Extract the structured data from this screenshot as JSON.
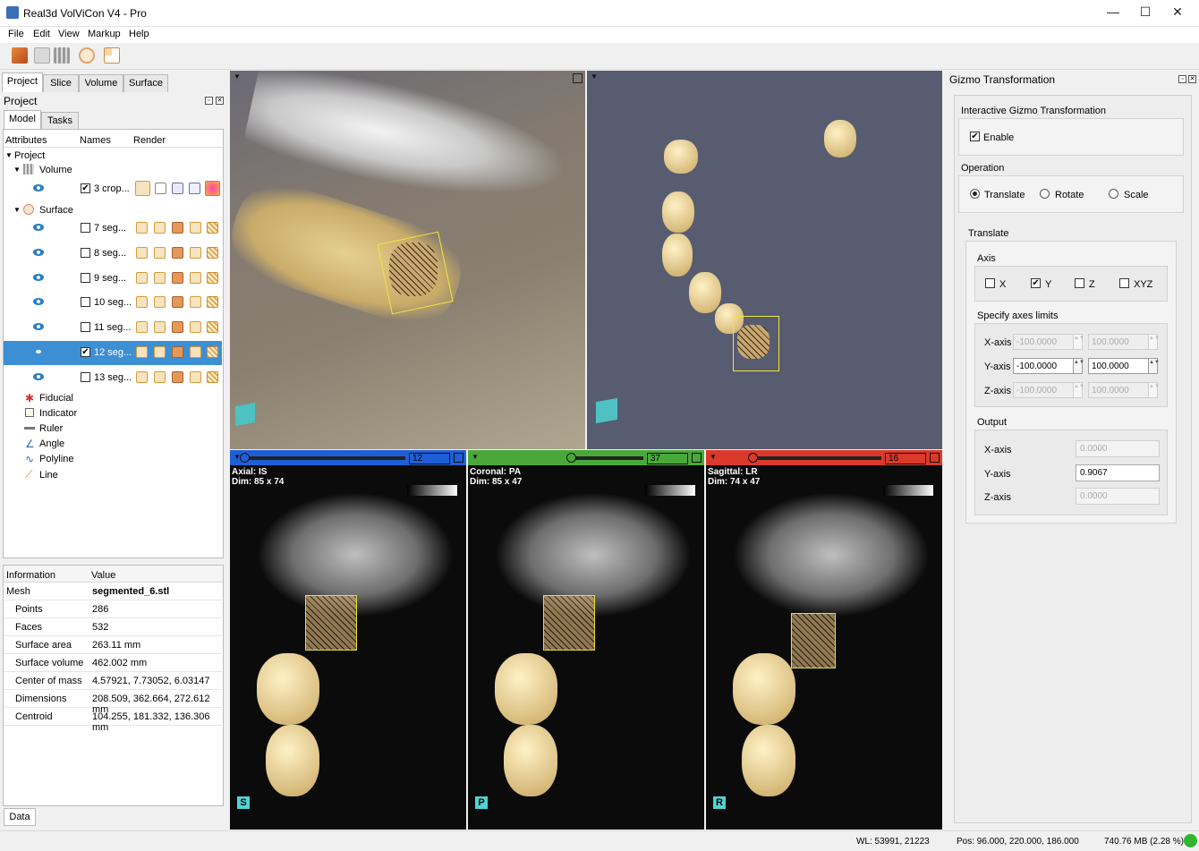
{
  "window": {
    "title": "Real3d VolViCon V4 - Pro",
    "minimize": "—",
    "maximize": "☐",
    "close": "✕"
  },
  "menu": [
    "File",
    "Edit",
    "View",
    "Markup",
    "Help"
  ],
  "left_tabs": [
    "Project",
    "Slice",
    "Volume",
    "Surface"
  ],
  "project_panel": {
    "title": "Project",
    "subtabs": [
      "Model",
      "Tasks"
    ],
    "columns": [
      "Attributes",
      "Names",
      "Render"
    ],
    "root": "Project",
    "volume_group": "Volume",
    "volume_item": {
      "name": "3 crop...",
      "checked": true
    },
    "surface_group": "Surface",
    "surface_items": [
      {
        "name": "7 seg...",
        "checked": false,
        "selected": false
      },
      {
        "name": "8 seg...",
        "checked": false,
        "selected": false
      },
      {
        "name": "9 seg...",
        "checked": false,
        "selected": false
      },
      {
        "name": "10 seg...",
        "checked": false,
        "selected": false
      },
      {
        "name": "11 seg...",
        "checked": false,
        "selected": false
      },
      {
        "name": "12 seg...",
        "checked": true,
        "selected": true
      },
      {
        "name": "13 seg...",
        "checked": false,
        "selected": false
      }
    ],
    "tools": [
      "Fiducial",
      "Indicator",
      "Ruler",
      "Angle",
      "Polyline",
      "Line"
    ]
  },
  "info_panel": {
    "columns": [
      "Information",
      "Value"
    ],
    "rows": [
      {
        "label": "Mesh",
        "value": "segmented_6.stl"
      },
      {
        "label": "Points",
        "value": "286"
      },
      {
        "label": "Faces",
        "value": "532"
      },
      {
        "label": "Surface area",
        "value": "263.11 mm"
      },
      {
        "label": "Surface volume",
        "value": "462.002 mm"
      },
      {
        "label": "Center of mass",
        "value": "4.57921, 7.73052, 6.03147"
      },
      {
        "label": "Dimensions",
        "value": "208.509, 362.664, 272.612 mm"
      },
      {
        "label": "Centroid",
        "value": "104.255, 181.332, 136.306 mm"
      }
    ],
    "bottom_tab": "Data"
  },
  "viewports": {
    "axial": {
      "slice": "12",
      "label": "Axial: IS",
      "dim": "Dim: 85 x 74",
      "orient": "S",
      "slider_fraction": 0.0
    },
    "coronal": {
      "slice": "37",
      "label": "Coronal: PA",
      "dim": "Dim: 85 x 47",
      "orient": "P",
      "slider_fraction": 0.55
    },
    "sagittal": {
      "slice": "16",
      "label": "Sagittal: LR",
      "dim": "Dim: 74 x 47",
      "orient": "R",
      "slider_fraction": 0.2
    },
    "colors": {
      "axial": "#1f5fd6",
      "coronal": "#4aa83a",
      "sagittal": "#d93a2c"
    }
  },
  "gizmo": {
    "title": "Gizmo Transformation",
    "interactive_group": "Interactive Gizmo Transformation",
    "enable_label": "Enable",
    "enable_checked": true,
    "operation_label": "Operation",
    "operations": [
      {
        "label": "Translate",
        "on": true
      },
      {
        "label": "Rotate",
        "on": false
      },
      {
        "label": "Scale",
        "on": false
      }
    ],
    "translate_label": "Translate",
    "axis_label": "Axis",
    "axes": [
      {
        "label": "X",
        "checked": false
      },
      {
        "label": "Y",
        "checked": true
      },
      {
        "label": "Z",
        "checked": false
      },
      {
        "label": "XYZ",
        "checked": false
      }
    ],
    "limits_label": "Specify axes limits",
    "limits": [
      {
        "label": "X-axis",
        "min": "-100.0000",
        "max": "100.0000",
        "enabled": false
      },
      {
        "label": "Y-axis",
        "min": "-100.0000",
        "max": "100.0000",
        "enabled": true
      },
      {
        "label": "Z-axis",
        "min": "-100.0000",
        "max": "100.0000",
        "enabled": false
      }
    ],
    "output_label": "Output",
    "outputs": [
      {
        "label": "X-axis",
        "value": "0.0000",
        "enabled": false
      },
      {
        "label": "Y-axis",
        "value": "0.9067",
        "enabled": true
      },
      {
        "label": "Z-axis",
        "value": "0.0000",
        "enabled": false
      }
    ]
  },
  "status": {
    "wl": "WL: 53991, 21223",
    "pos": "Pos: 96.000, 220.000, 186.000",
    "mem": "740.76 MB (2.28 %)",
    "indicator_color": "#2fb52f"
  }
}
